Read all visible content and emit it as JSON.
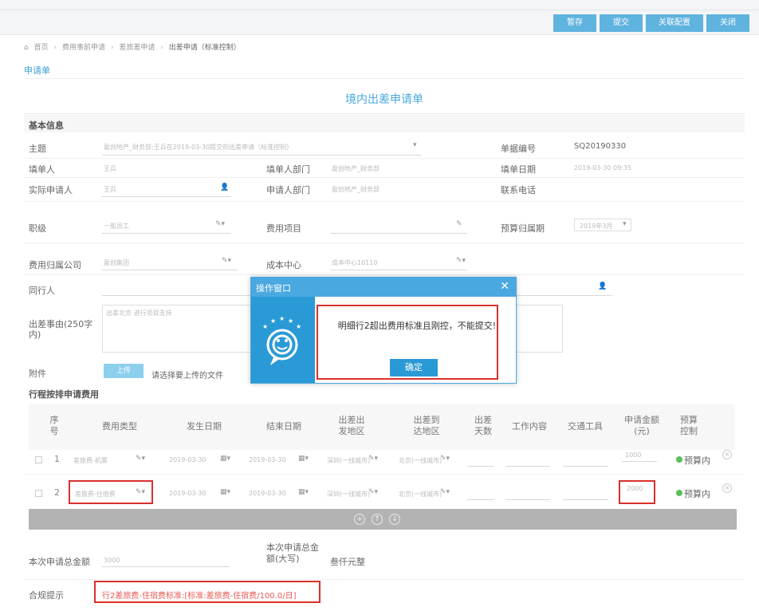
{
  "toolbar": {
    "buttons": [
      "暂存",
      "提交",
      "关联配置",
      "关闭"
    ]
  },
  "breadcrumb": {
    "items": [
      "首页",
      "费用事前申请",
      "差旅差申请",
      "出差申请（标准控制）"
    ]
  },
  "sheet_tab": "申请单",
  "form_title": "境内出差申请单",
  "basic_info": {
    "heading": "基本信息",
    "subject_label": "主题",
    "subject_value": "盈创地产_财务部:王兵在2019-03-30提交的出差申请（标准控制）",
    "doc_no_label": "单据编号",
    "doc_no_value": "SQ20190330",
    "filler_label": "填单人",
    "filler_value": "王兵",
    "filler_dept_label": "填单人部门",
    "filler_dept_value": "盈创地产_财务部",
    "fill_date_label": "填单日期",
    "fill_date_value": "2019-03-30 09:35",
    "applicant_label": "实际申请人",
    "applicant_value": "王兵",
    "applicant_dept_label": "申请人部门",
    "applicant_dept_value": "盈创地产_财务部",
    "phone_label": "联系电话",
    "level_label": "职级",
    "level_value": "一般员工",
    "expense_item_label": "费用项目",
    "budget_period_label": "预算归属期",
    "budget_period_value": "2019年3月",
    "company_label": "费用归属公司",
    "company_value": "盈创集团",
    "cost_center_label": "成本中心",
    "cost_center_value": "成本中心10110",
    "companion_label": "同行人",
    "reason_label": "出差事由(250字内)",
    "reason_value": "出差北京 进行项目支持",
    "attachment_label": "附件",
    "upload_label": "上传",
    "upload_hint": "请选择要上传的文件"
  },
  "itinerary": {
    "heading": "行程按排申请费用",
    "columns": [
      "序号",
      "费用类型",
      "发生日期",
      "结束日期",
      "出差出发地区",
      "出差到达地区",
      "出差天数",
      "工作内容",
      "交通工具",
      "申请金额(元)",
      "预算控制"
    ],
    "rows": [
      {
        "no": "1",
        "type": "差旅费-机票",
        "start": "2019-03-30",
        "end": "2019-03-30",
        "from": "深圳(一线城市)",
        "to": "北京(一线城市)",
        "amount": "1000",
        "budget": "预算内"
      },
      {
        "no": "2",
        "type": "差旅费-住宿费",
        "start": "2019-03-30",
        "end": "2019-03-30",
        "from": "深圳(一线城市)",
        "to": "北京(一线城市)",
        "amount": "2000",
        "budget": "预算内"
      }
    ]
  },
  "totals": {
    "total_label": "本次申请总金额",
    "total_value": "3000",
    "total_upper_label": "本次申请总金额(大写)",
    "total_upper_value": "叁仟元整"
  },
  "compliance": {
    "label": "合规提示",
    "text": "行2差旅费-住宿费标准:[标准:差旅费-住宿费/100.0/日]"
  },
  "modal": {
    "title": "操作窗口",
    "message": "明细行2超出费用标准且刚控，不能提交!",
    "ok_label": "确定"
  },
  "colors": {
    "accent": "#4aa8e0",
    "highlight_red": "#d9302c",
    "toolbar_button": "#5fb3df",
    "ok_green": "#5bbf5b"
  }
}
